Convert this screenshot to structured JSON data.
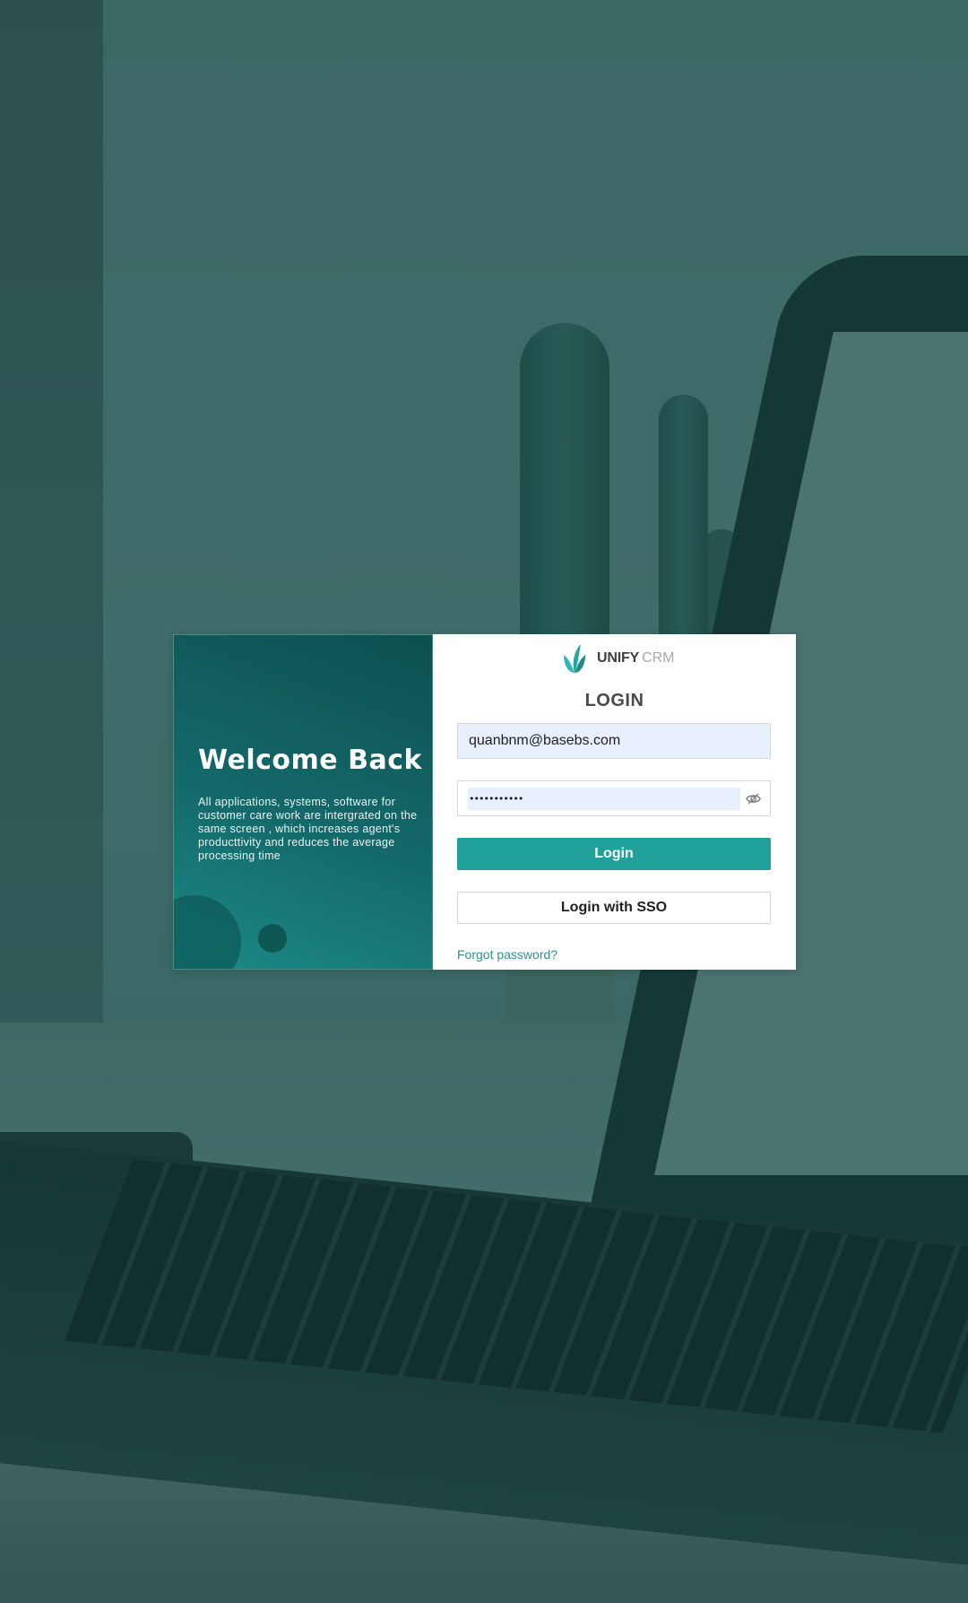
{
  "brand": {
    "name": "UNIFY",
    "suffix": "CRM",
    "accent_color": "#21a19c"
  },
  "welcome": {
    "title": "Welcome Back",
    "description": "All applications, systems, software for customer care work are intergrated on the same screen , which increases agent's producttivity and reduces the average processing time"
  },
  "login_form": {
    "title": "LOGIN",
    "email": {
      "value": "quanbnm@basebs.com"
    },
    "password": {
      "value": "•••••••••••",
      "toggle_icon": "eye-off-icon"
    },
    "login_button_label": "Login",
    "sso_button_label": "Login with SSO",
    "forgot_password_label": "Forgot password?"
  }
}
